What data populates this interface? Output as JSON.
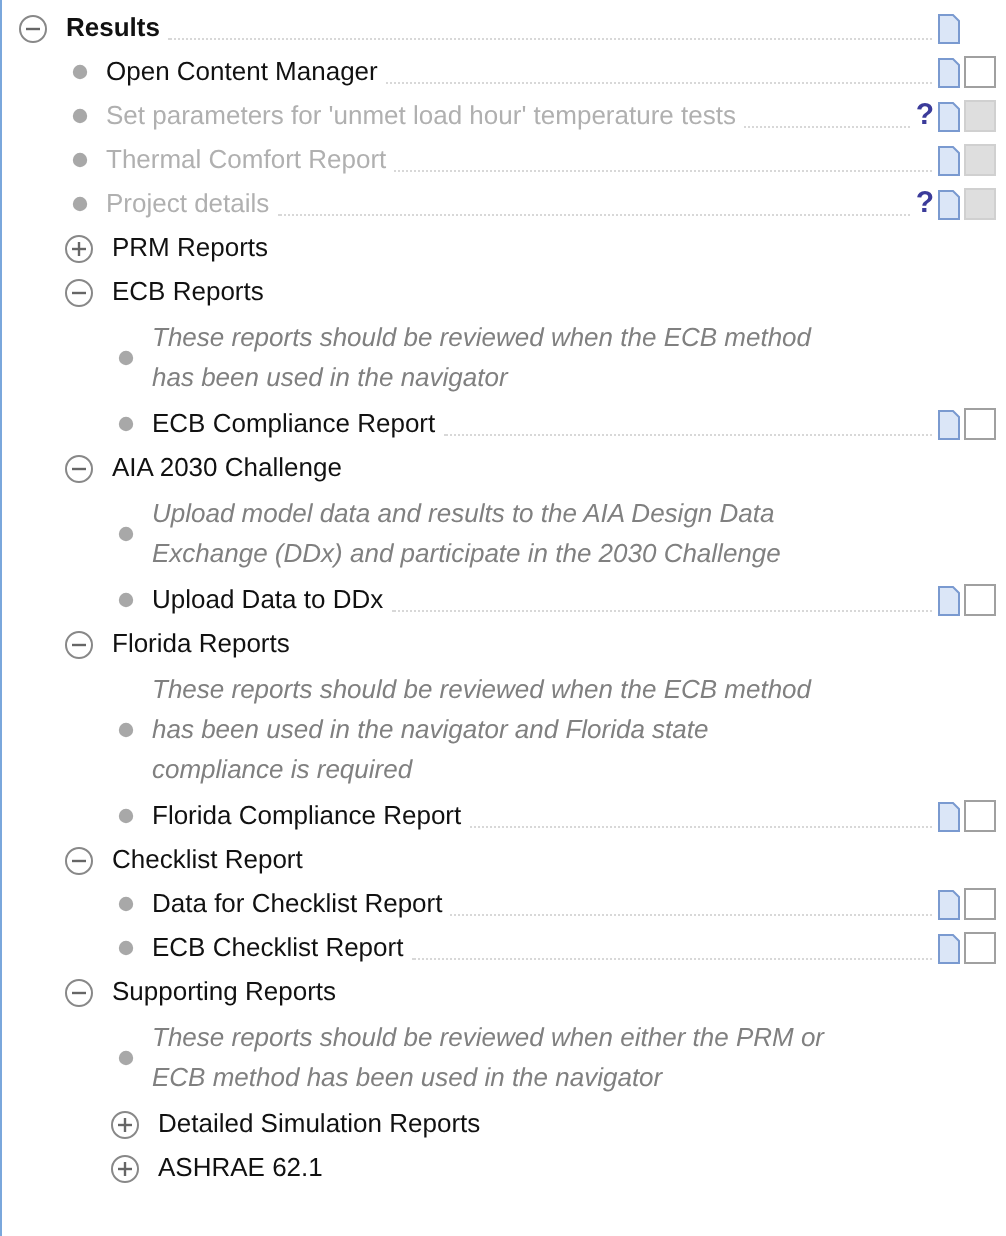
{
  "tree": {
    "kind": "group",
    "label": "Results",
    "expanded": true,
    "doc": true,
    "children": [
      {
        "kind": "task",
        "label": "Open Content Manager",
        "disabled": false,
        "doc": true,
        "checked": false
      },
      {
        "kind": "task",
        "label": "Set parameters for 'unmet load hour' temperature tests",
        "disabled": true,
        "help": "?",
        "doc": true,
        "checked": false
      },
      {
        "kind": "task",
        "label": "Thermal Comfort Report",
        "disabled": true,
        "doc": true,
        "checked": false
      },
      {
        "kind": "task",
        "label": "Project details",
        "disabled": true,
        "help": "?",
        "doc": true,
        "checked": false
      },
      {
        "kind": "group",
        "label": "PRM Reports",
        "expanded": false
      },
      {
        "kind": "group",
        "label": "ECB Reports",
        "expanded": true,
        "children": [
          {
            "kind": "note",
            "text": "These reports should be reviewed when the ECB method has been used in the navigator"
          },
          {
            "kind": "task",
            "label": "ECB Compliance Report",
            "disabled": false,
            "doc": true,
            "checked": false
          }
        ]
      },
      {
        "kind": "group",
        "label": "AIA 2030 Challenge",
        "expanded": true,
        "children": [
          {
            "kind": "note",
            "text": "Upload model data and results to the AIA Design Data Exchange (DDx) and participate in the 2030 Challenge"
          },
          {
            "kind": "task",
            "label": "Upload Data to DDx",
            "disabled": false,
            "doc": true,
            "checked": false
          }
        ]
      },
      {
        "kind": "group",
        "label": "Florida Reports",
        "expanded": true,
        "children": [
          {
            "kind": "note",
            "text": "These reports should be reviewed when the ECB method has been used in the navigator and Florida state compliance is required"
          },
          {
            "kind": "task",
            "label": "Florida Compliance Report",
            "disabled": false,
            "doc": true,
            "checked": false
          }
        ]
      },
      {
        "kind": "group",
        "label": "Checklist Report",
        "expanded": true,
        "children": [
          {
            "kind": "task",
            "label": "Data for Checklist Report",
            "disabled": false,
            "doc": true,
            "checked": false
          },
          {
            "kind": "task",
            "label": "ECB Checklist Report",
            "disabled": false,
            "doc": true,
            "checked": false
          }
        ]
      },
      {
        "kind": "group",
        "label": "Supporting Reports",
        "expanded": true,
        "children": [
          {
            "kind": "note",
            "text": "These reports should be reviewed when either the PRM or ECB method has been used in the navigator"
          },
          {
            "kind": "group",
            "label": "Detailed Simulation Reports",
            "expanded": false
          },
          {
            "kind": "group",
            "label": "ASHRAE 62.1",
            "expanded": false
          }
        ]
      }
    ]
  }
}
